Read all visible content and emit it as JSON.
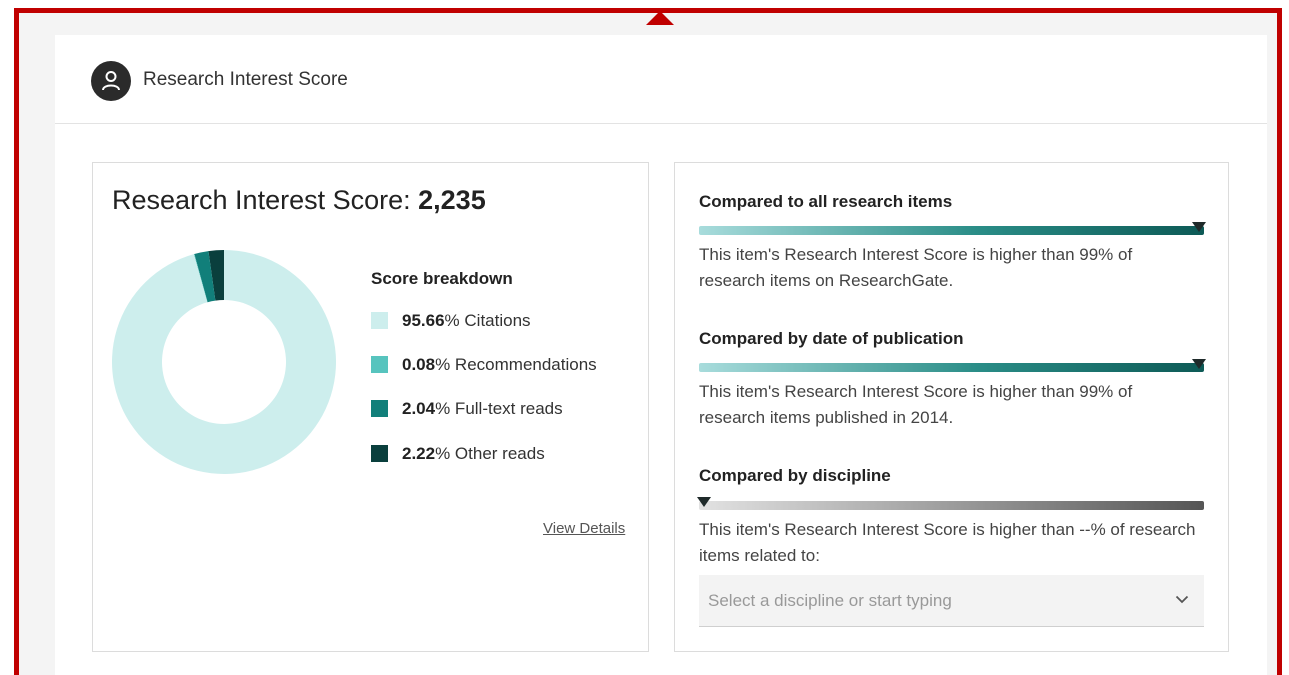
{
  "header": {
    "title": "Research Interest Score",
    "avatar_icon": "user-icon"
  },
  "score_panel": {
    "title_prefix": "Research Interest Score: ",
    "score": "2,235",
    "breakdown_title": "Score breakdown",
    "items": [
      {
        "value": "95.66",
        "label": "% Citations",
        "color": "#cdeeed"
      },
      {
        "value": "0.08",
        "label": "% Recommendations",
        "color": "#57c4be"
      },
      {
        "value": "2.04",
        "label": "% Full-text reads",
        "color": "#117f7a"
      },
      {
        "value": "2.22",
        "label": "% Other reads",
        "color": "#0a3f3d"
      }
    ],
    "view_details": "View Details"
  },
  "chart_data": {
    "type": "pie",
    "categories": [
      "Citations",
      "Recommendations",
      "Full-text reads",
      "Other reads"
    ],
    "values": [
      95.66,
      0.08,
      2.04,
      2.22
    ],
    "colors": [
      "#cdeeed",
      "#57c4be",
      "#117f7a",
      "#0a3f3d"
    ],
    "donut": true
  },
  "comparisons": [
    {
      "title": "Compared to all research items",
      "description": "This item's Research Interest Score is higher than 99% of research items on ResearchGate.",
      "percentile": 99,
      "style": "teal"
    },
    {
      "title": "Compared by date of publication",
      "description": "This item's Research Interest Score is higher than 99% of research items published in 2014.",
      "percentile": 99,
      "style": "teal"
    },
    {
      "title": "Compared by discipline",
      "description": "This item's Research Interest Score is higher than --% of research items related to:",
      "percentile": 0,
      "style": "gray"
    }
  ],
  "discipline_select": {
    "placeholder": "Select a discipline or start typing",
    "icon": "chevron-down-icon"
  }
}
